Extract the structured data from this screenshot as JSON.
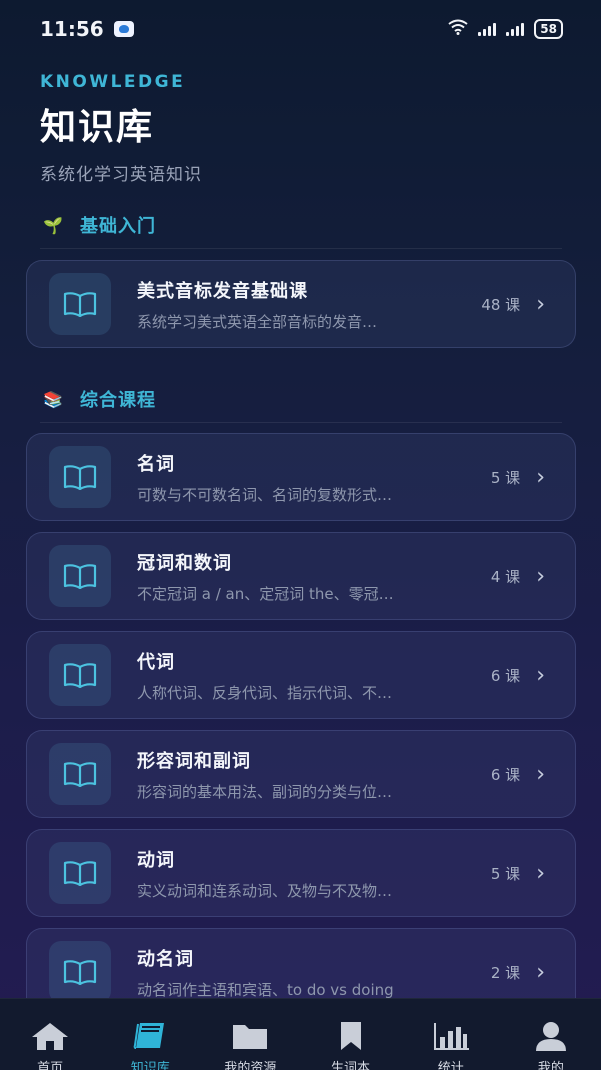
{
  "status_bar": {
    "time": "11:56",
    "battery": "58",
    "app_icon": "message-icon",
    "wifi_icon": "wifi-icon",
    "signal_icon": "signal-icon"
  },
  "header": {
    "eyebrow": "KNOWLEDGE",
    "title": "知识库",
    "subtitle": "系统化学习英语知识"
  },
  "sections": [
    {
      "icon": "seedling-icon",
      "icon_glyph": "🌱",
      "label": "基础入门",
      "courses": [
        {
          "title": "美式音标发音基础课",
          "desc": "系统学习美式英语全部音标的发音…",
          "count": "48 课"
        }
      ]
    },
    {
      "icon": "books-icon",
      "icon_glyph": "📚",
      "label": "综合课程",
      "courses": [
        {
          "title": "名词",
          "desc": "可数与不可数名词、名词的复数形式…",
          "count": "5 课"
        },
        {
          "title": "冠词和数词",
          "desc": "不定冠词 a / an、定冠词 the、零冠…",
          "count": "4 课"
        },
        {
          "title": "代词",
          "desc": "人称代词、反身代词、指示代词、不…",
          "count": "6 课"
        },
        {
          "title": "形容词和副词",
          "desc": "形容词的基本用法、副词的分类与位…",
          "count": "6 课"
        },
        {
          "title": "动词",
          "desc": "实义动词和连系动词、及物与不及物…",
          "count": "5 课"
        },
        {
          "title": "动名词",
          "desc": "动名词作主语和宾语、to do vs doing",
          "count": "2 课"
        }
      ]
    }
  ],
  "tab_bar": {
    "items": [
      {
        "label": "首页",
        "icon": "home-icon",
        "active": false
      },
      {
        "label": "知识库",
        "icon": "book-icon",
        "active": true
      },
      {
        "label": "我的资源",
        "icon": "folder-icon",
        "active": false
      },
      {
        "label": "生词本",
        "icon": "bookmark-icon",
        "active": false
      },
      {
        "label": "统计",
        "icon": "bar-chart-icon",
        "active": false
      },
      {
        "label": "我的",
        "icon": "user-icon",
        "active": false
      }
    ]
  },
  "colors": {
    "accent": "#3fb6d6",
    "background_top": "#0d1a30",
    "background_bottom": "#231b52"
  }
}
